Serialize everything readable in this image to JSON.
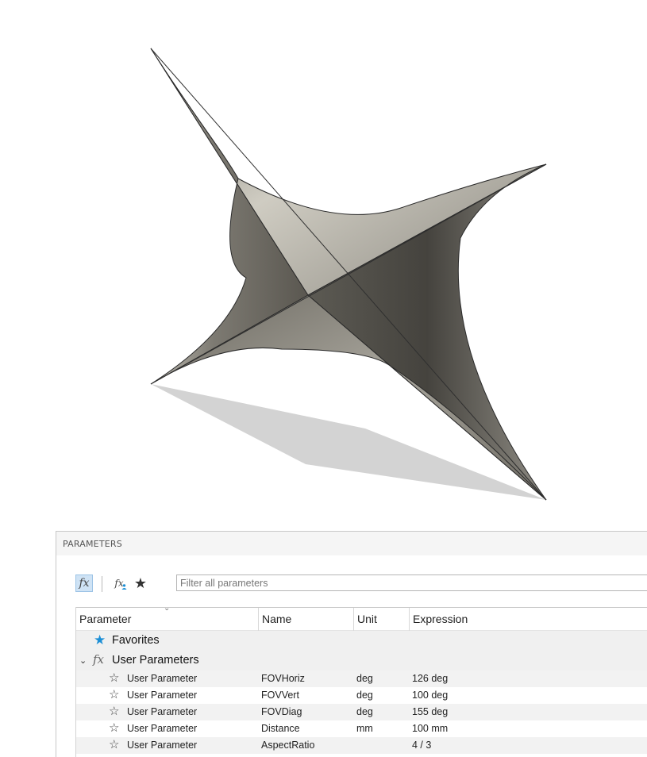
{
  "viewport": {
    "model_color": "#8f8c84",
    "shadow_color": "#d3d3d3"
  },
  "panel": {
    "title": "PARAMETERS",
    "filter_placeholder": "Filter all parameters",
    "toolbar": {
      "all_parameters_icon": "fx-icon",
      "user_parameters_icon": "fx-user-icon",
      "favorites_icon": "star-icon"
    },
    "columns": [
      "Parameter",
      "Name",
      "Unit",
      "Expression"
    ],
    "groups": {
      "favorites": {
        "label": "Favorites",
        "icon": "star-filled-icon",
        "icon_color": "#1c8fd6"
      },
      "user_parameters": {
        "label": "User Parameters",
        "icon": "fx-icon",
        "expanded": true
      }
    },
    "rows": [
      {
        "parameter": "User Parameter",
        "name": "FOVHoriz",
        "unit": "deg",
        "expression": "126 deg"
      },
      {
        "parameter": "User Parameter",
        "name": "FOVVert",
        "unit": "deg",
        "expression": "100 deg"
      },
      {
        "parameter": "User Parameter",
        "name": "FOVDiag",
        "unit": "deg",
        "expression": "155 deg"
      },
      {
        "parameter": "User Parameter",
        "name": "Distance",
        "unit": "mm",
        "expression": "100 mm"
      },
      {
        "parameter": "User Parameter",
        "name": "AspectRatio",
        "unit": "",
        "expression": "4 / 3"
      }
    ]
  }
}
